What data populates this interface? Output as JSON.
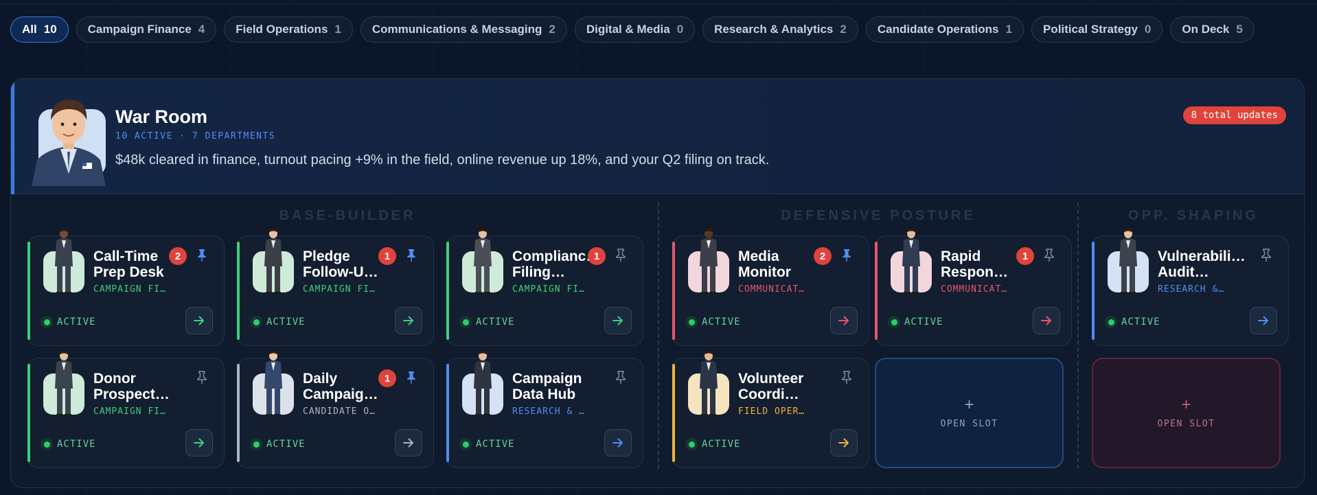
{
  "tabs": [
    {
      "label": "All",
      "count": "10",
      "active": true
    },
    {
      "label": "Campaign Finance",
      "count": "4"
    },
    {
      "label": "Field Operations",
      "count": "1"
    },
    {
      "label": "Communications & Messaging",
      "count": "2"
    },
    {
      "label": "Digital & Media",
      "count": "0"
    },
    {
      "label": "Research & Analytics",
      "count": "2"
    },
    {
      "label": "Candidate Operations",
      "count": "1"
    },
    {
      "label": "Political Strategy",
      "count": "0"
    },
    {
      "label": "On Deck",
      "count": "5"
    }
  ],
  "header": {
    "title": "War Room",
    "meta": "10 ACTIVE · 7 DEPARTMENTS",
    "summary": "$48k cleared in finance, turnout pacing +9% in the field, online revenue up 18%, and your Q2 filing on track.",
    "updates_badge": "8 total updates",
    "avatar_icon": "candidate-portrait"
  },
  "sections": {
    "base_builder": "BASE-BUILDER",
    "defensive": "DEFENSIVE POSTURE",
    "opp": "OPP. SHAPING"
  },
  "colors": {
    "finance": "#3ecf7a",
    "comms": "#e5566a",
    "research": "#4f8ff0",
    "field": "#f0b43a",
    "candidate": "#aab4c4"
  },
  "cards": [
    {
      "name": "Call-Time Prep Desk",
      "dept": "CAMPAIGN FI…",
      "badge": "2",
      "pinned": true,
      "status": "ACTIVE"
    },
    {
      "name": "Pledge Follow-U…",
      "dept": "CAMPAIGN FI…",
      "badge": "1",
      "pinned": true,
      "status": "ACTIVE"
    },
    {
      "name": "Complianc… Filing…",
      "dept": "CAMPAIGN FI…",
      "badge": "1",
      "pinned": false,
      "status": "ACTIVE"
    },
    {
      "name": "Donor Prospect…",
      "dept": "CAMPAIGN FI…",
      "badge": "",
      "pinned": false,
      "status": "ACTIVE"
    },
    {
      "name": "Daily Campaig…",
      "dept": "CANDIDATE O…",
      "badge": "1",
      "pinned": true,
      "status": "ACTIVE"
    },
    {
      "name": "Campaign Data Hub",
      "dept": "RESEARCH & …",
      "badge": "",
      "pinned": false,
      "status": "ACTIVE"
    },
    {
      "name": "Media Monitor",
      "dept": "COMMUNICAT…",
      "badge": "2",
      "pinned": true,
      "status": "ACTIVE"
    },
    {
      "name": "Rapid Respon…",
      "dept": "COMMUNICAT…",
      "badge": "1",
      "pinned": false,
      "status": "ACTIVE"
    },
    {
      "name": "Volunteer Coordi…",
      "dept": "FIELD OPER…",
      "badge": "",
      "pinned": false,
      "status": "ACTIVE"
    },
    {
      "name": "Vulnerabili… Audit…",
      "dept": "RESEARCH &…",
      "badge": "",
      "pinned": false,
      "status": "ACTIVE"
    }
  ],
  "open_slot": {
    "plus": "+",
    "label": "OPEN SLOT"
  }
}
